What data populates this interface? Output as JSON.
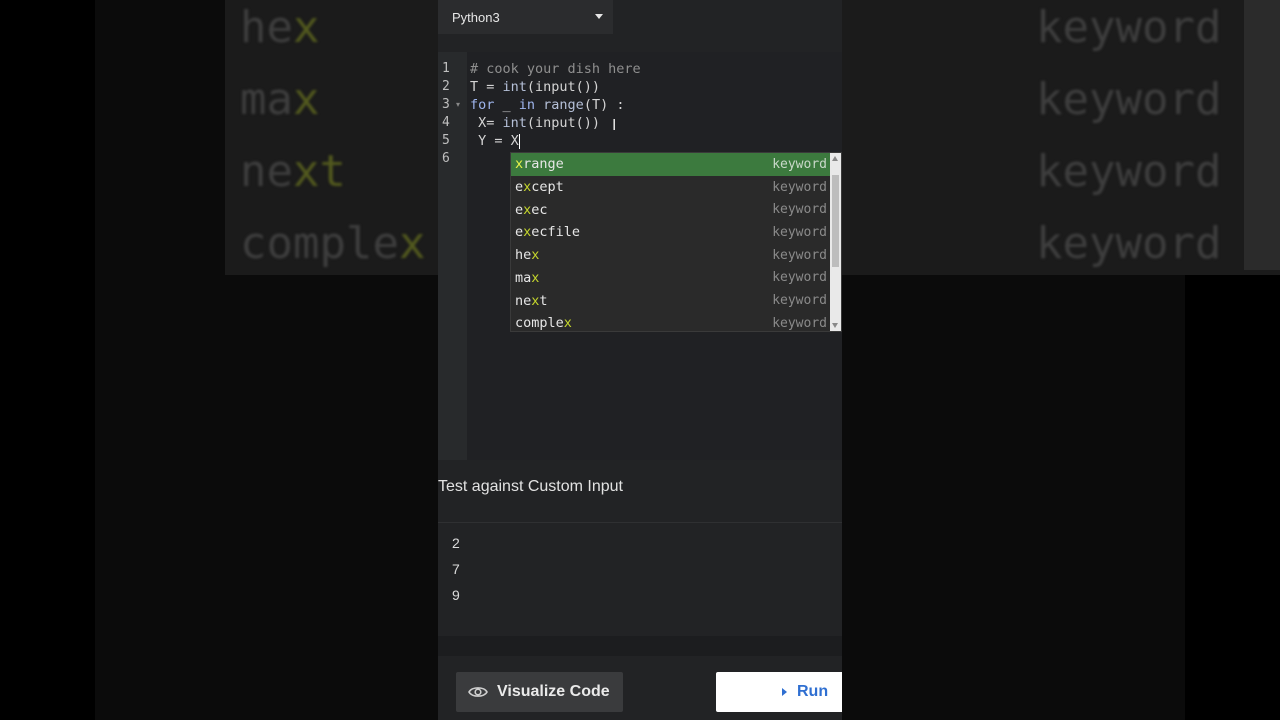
{
  "background": {
    "left_words": [
      {
        "plain": "he",
        "match": "x"
      },
      {
        "plain": "ma",
        "match": "x"
      },
      {
        "plain": "ne",
        "match": "xt"
      },
      {
        "plain": "comple",
        "match": "x"
      }
    ],
    "right_label": "keyword"
  },
  "language_select": {
    "value": "Python3"
  },
  "editor": {
    "line_numbers": [
      "1",
      "2",
      "3",
      "4",
      "5",
      "6"
    ],
    "lines": {
      "l1": "# cook your dish here",
      "l2_var": "T = ",
      "l2_fn": "int",
      "l2_rest": "(input())",
      "l3_kw": "for",
      "l3_mid": " _ ",
      "l3_kw2": "in",
      "l3_fn": " range",
      "l3_rest": "(T) :",
      "l4_var": " X= ",
      "l4_fn": "int",
      "l4_rest": "(input())",
      "l5": " Y = X"
    }
  },
  "autocomplete": {
    "items": [
      {
        "match": "x",
        "rest": "range",
        "meta": "keyword",
        "selected": true
      },
      {
        "pre": "e",
        "match": "x",
        "rest": "cept",
        "meta": "keyword"
      },
      {
        "pre": "e",
        "match": "x",
        "rest": "ec",
        "meta": "keyword"
      },
      {
        "pre": "e",
        "match": "x",
        "rest": "ecfile",
        "meta": "keyword"
      },
      {
        "pre": "he",
        "match": "x",
        "rest": "",
        "meta": "keyword"
      },
      {
        "pre": "ma",
        "match": "x",
        "rest": "",
        "meta": "keyword"
      },
      {
        "pre": "ne",
        "match": "x",
        "rest": "t",
        "meta": "keyword"
      },
      {
        "pre": "comple",
        "match": "x",
        "rest": "",
        "meta": "keyword"
      }
    ]
  },
  "custom_input": {
    "title": "Test against Custom Input",
    "values": [
      "2",
      "7",
      "9"
    ]
  },
  "buttons": {
    "visualize": "Visualize Code",
    "run": "Run"
  },
  "colors": {
    "selected_item": "#3c7a3e",
    "match_highlight": "#c4d52d",
    "run_text": "#2f6fd1"
  }
}
